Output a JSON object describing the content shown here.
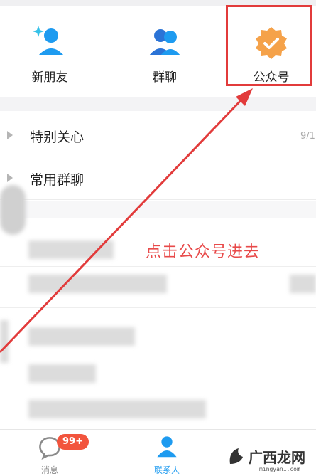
{
  "quick_entries": [
    {
      "label": "新朋友",
      "icon": "add-friend-icon"
    },
    {
      "label": "群聊",
      "icon": "group-chat-icon"
    },
    {
      "label": "公众号",
      "icon": "official-account-badge-icon"
    }
  ],
  "groups": [
    {
      "label": "特别关心",
      "count": "9/1"
    },
    {
      "label": "常用群聊"
    }
  ],
  "annotation": "点击公众号进去",
  "tabs": [
    {
      "label": "消息",
      "icon": "message-icon"
    },
    {
      "label": "联系人",
      "icon": "contacts-icon"
    }
  ],
  "badge": "99+",
  "watermark": {
    "text": "广西龙网",
    "url": "mingyan1.com"
  },
  "colors": {
    "accent": "#1e9bf0",
    "highlight": "#e23b3b",
    "orange": "#f5a24a"
  }
}
